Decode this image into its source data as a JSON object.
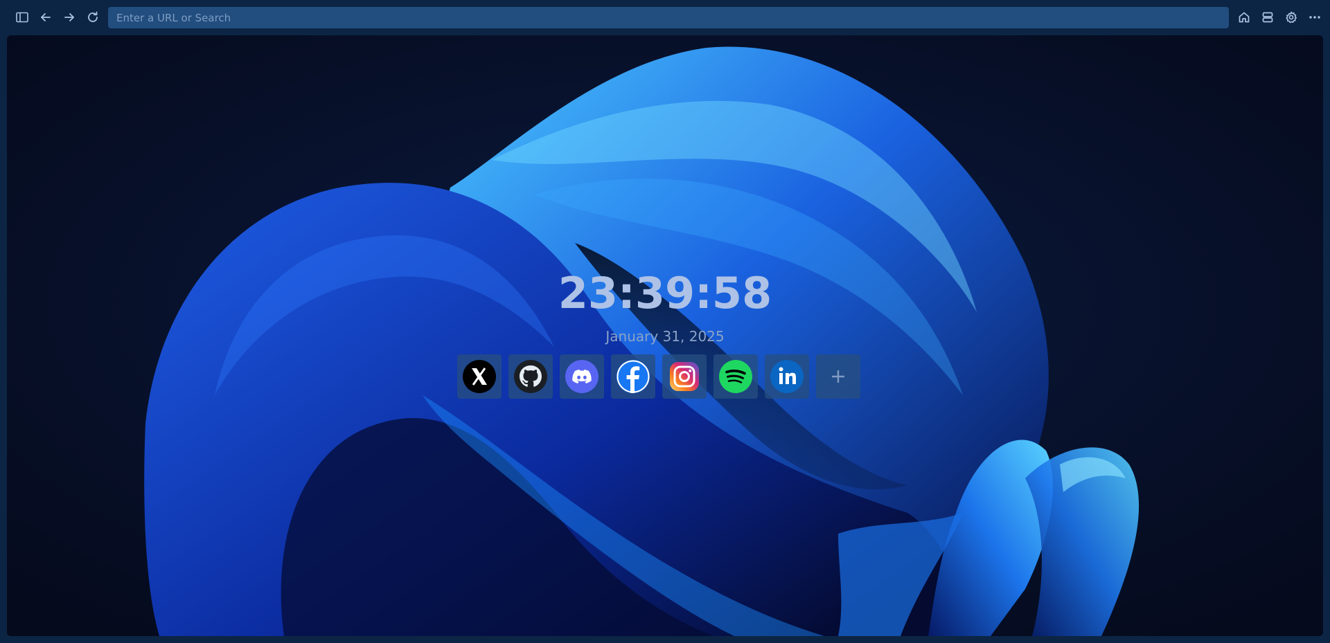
{
  "toolbar": {
    "url_placeholder": "Enter a URL or Search",
    "url_value": "",
    "icons": [
      "sidebar-icon",
      "back-arrow-icon",
      "forward-arrow-icon",
      "reload-icon",
      "home-icon",
      "bookmarks-icon",
      "gear-icon",
      "more-dots-icon"
    ]
  },
  "clock": {
    "time": "23:39:58",
    "date": "January 31, 2025"
  },
  "shortcuts": [
    {
      "icon": "x-icon",
      "color": "#000000"
    },
    {
      "icon": "github-icon",
      "color": "#1b1f24"
    },
    {
      "icon": "discord-icon",
      "color": "#5865f2"
    },
    {
      "icon": "facebook-icon",
      "color": "#1877f2"
    },
    {
      "icon": "instagram-icon",
      "color": "#d62976"
    },
    {
      "icon": "spotify-icon",
      "color": "#1ed760"
    },
    {
      "icon": "linkedin-icon",
      "color": "#0a66c2"
    },
    {
      "icon": "plus-icon",
      "color": "#7f9cc2"
    }
  ],
  "colors": {
    "toolbar_bg": "#0c2544",
    "url_bar_bg": "#224d7f",
    "clock_text": "#adc2e6",
    "date_text": "#8aa3c9"
  }
}
